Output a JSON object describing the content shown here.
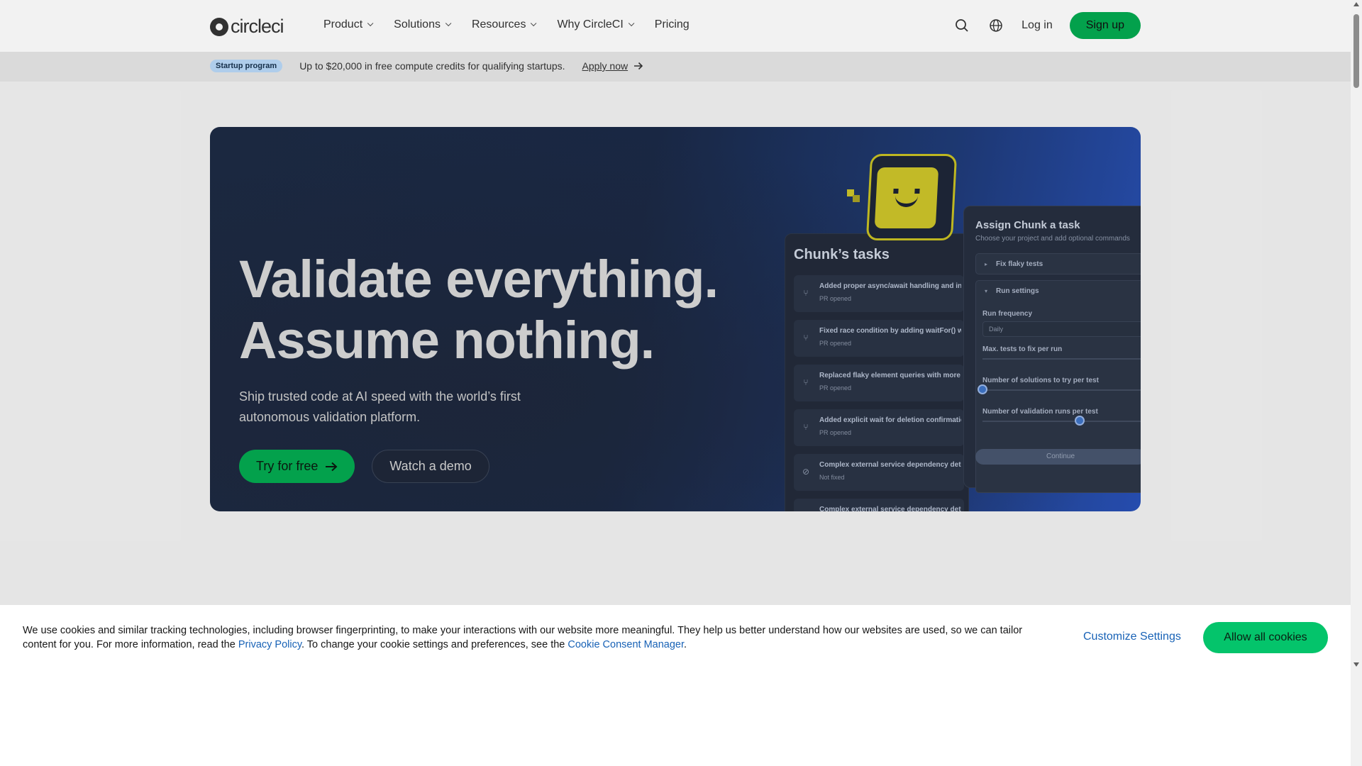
{
  "header": {
    "logo_text": "circleci",
    "nav": [
      {
        "label": "Product"
      },
      {
        "label": "Solutions"
      },
      {
        "label": "Resources"
      },
      {
        "label": "Why CircleCI"
      },
      {
        "label": "Pricing"
      }
    ],
    "login_label": "Log in",
    "signup_label": "Sign up"
  },
  "promo": {
    "badge": "Startup program",
    "text": "Up to $20,000 in free compute credits for qualifying startups.",
    "link": "Apply now"
  },
  "hero": {
    "title_line1": "Validate everything.",
    "title_line2": "Assume nothing.",
    "subtitle": "Ship trusted code at AI speed with the world’s first autonomous validation platform.",
    "cta_primary": "Try for free",
    "cta_secondary": "Watch a demo"
  },
  "mockup": {
    "tasks_title": "Chunk’s tasks",
    "tasks": [
      {
        "title": "Added proper async/await handling and inc",
        "status": "PR opened"
      },
      {
        "title": "Fixed race condition by adding waitFor() wi",
        "status": "PR opened"
      },
      {
        "title": "Replaced flaky element queries with more r",
        "status": "PR opened"
      },
      {
        "title": "Added explicit wait for deletion confirmatio",
        "status": "PR opened"
      },
      {
        "title": "Complex external service dependency dete",
        "status": "Not fixed"
      },
      {
        "title": "Complex external service dependency detected - requires manual review",
        "status": ""
      }
    ],
    "assign_title": "Assign Chunk a task",
    "assign_desc": "Choose your project and add optional commands",
    "accordion_fix": "Fix flaky tests",
    "accordion_run": "Run settings",
    "run_frequency_label": "Run frequency",
    "run_frequency_value": "Daily",
    "max_tests_label": "Max. tests to fix per run",
    "solutions_label": "Number of solutions to try per test",
    "validation_label": "Number of validation runs per test",
    "continue_label": "Continue"
  },
  "cookie": {
    "text_a": "We use cookies and similar tracking technologies, including browser fingerprinting, to make your interactions with our website more meaningful. They help us better understand how our websites are used, so we can tailor content for you. For more information, read the ",
    "privacy_link": "Privacy Policy",
    "text_b": ". To change your cookie settings and preferences, see the ",
    "consent_link": "Cookie Consent Manager",
    "text_c": ".",
    "customize_label": "Customize Settings",
    "allow_label": "Allow all cookies"
  },
  "colors": {
    "brand_green": "#04aa51",
    "allow_green": "#04c46b",
    "link_blue": "#1862b6",
    "hero_navy": "#1d2b44"
  }
}
